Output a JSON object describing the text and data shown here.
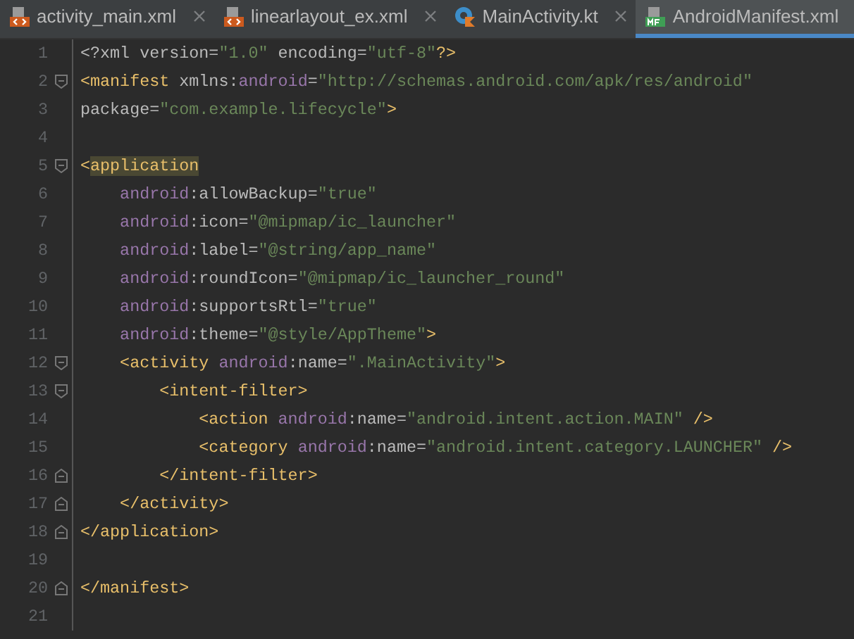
{
  "tabs": [
    {
      "label": "activity_main.xml",
      "kind": "xml",
      "selected": false
    },
    {
      "label": "linearlayout_ex.xml",
      "kind": "xml",
      "selected": false
    },
    {
      "label": "MainActivity.kt",
      "kind": "kotlin",
      "selected": false
    },
    {
      "label": "AndroidManifest.xml",
      "kind": "manifest",
      "selected": true
    }
  ],
  "editor": {
    "lines": [
      {
        "number": "1",
        "tokens": [
          {
            "kind": "plain",
            "text": "<?xml version="
          },
          {
            "kind": "value",
            "text": "\"1.0\""
          },
          {
            "kind": "plain",
            "text": " encoding="
          },
          {
            "kind": "value",
            "text": "\"utf-8\""
          },
          {
            "kind": "tag",
            "text": "?>"
          }
        ]
      },
      {
        "number": "2",
        "kind": "fold-start",
        "tokens": [
          {
            "kind": "tag",
            "text": "<manifest "
          },
          {
            "kind": "plain",
            "text": "xmlns:"
          },
          {
            "kind": "ns",
            "text": "android"
          },
          {
            "kind": "plain",
            "text": "="
          },
          {
            "kind": "value",
            "text": "\"http://schemas.android.com/apk/res/android\""
          }
        ]
      },
      {
        "number": "3",
        "tokens": [
          {
            "kind": "plain",
            "text": "package="
          },
          {
            "kind": "value",
            "text": "\"com.example.lifecycle\""
          },
          {
            "kind": "tag",
            "text": ">"
          }
        ]
      },
      {
        "number": "4"
      },
      {
        "number": "5",
        "kind": "fold-start",
        "tokens": [
          {
            "kind": "tag",
            "text": "<"
          },
          {
            "kind": "tag",
            "text": "application",
            "highlighted": true
          }
        ]
      },
      {
        "number": "6",
        "tokens": [
          {
            "kind": "ns",
            "text": "    android"
          },
          {
            "kind": "plain",
            "text": ":allowBackup="
          },
          {
            "kind": "value",
            "text": "\"true\""
          }
        ]
      },
      {
        "number": "7",
        "tokens": [
          {
            "kind": "ns",
            "text": "    android"
          },
          {
            "kind": "plain",
            "text": ":icon="
          },
          {
            "kind": "value",
            "text": "\"@mipmap/ic_launcher\""
          }
        ]
      },
      {
        "number": "8",
        "tokens": [
          {
            "kind": "ns",
            "text": "    android"
          },
          {
            "kind": "plain",
            "text": ":label="
          },
          {
            "kind": "value",
            "text": "\"@string/app_name\""
          }
        ]
      },
      {
        "number": "9",
        "tokens": [
          {
            "kind": "ns",
            "text": "    android"
          },
          {
            "kind": "plain",
            "text": ":roundIcon="
          },
          {
            "kind": "value",
            "text": "\"@mipmap/ic_launcher_round\""
          }
        ]
      },
      {
        "number": "10",
        "tokens": [
          {
            "kind": "ns",
            "text": "    android"
          },
          {
            "kind": "plain",
            "text": ":supportsRtl="
          },
          {
            "kind": "value",
            "text": "\"true\""
          }
        ]
      },
      {
        "number": "11",
        "tokens": [
          {
            "kind": "ns",
            "text": "    android"
          },
          {
            "kind": "plain",
            "text": ":theme="
          },
          {
            "kind": "value",
            "text": "\"@style/AppTheme\""
          },
          {
            "kind": "tag",
            "text": ">"
          }
        ]
      },
      {
        "number": "12",
        "kind": "fold-start",
        "tokens": [
          {
            "kind": "tag",
            "text": "    <activity "
          },
          {
            "kind": "ns",
            "text": "android"
          },
          {
            "kind": "plain",
            "text": ":name="
          },
          {
            "kind": "value",
            "text": "\".MainActivity\""
          },
          {
            "kind": "tag",
            "text": ">"
          }
        ]
      },
      {
        "number": "13",
        "kind": "fold-start",
        "tokens": [
          {
            "kind": "tag",
            "text": "        <intent-filter>"
          }
        ]
      },
      {
        "number": "14",
        "tokens": [
          {
            "kind": "tag",
            "text": "            <action "
          },
          {
            "kind": "ns",
            "text": "android"
          },
          {
            "kind": "plain",
            "text": ":name="
          },
          {
            "kind": "value",
            "text": "\"android.intent.action.MAIN\""
          },
          {
            "kind": "tag",
            "text": " />"
          }
        ]
      },
      {
        "number": "15",
        "tokens": [
          {
            "kind": "tag",
            "text": "            <category "
          },
          {
            "kind": "ns",
            "text": "android"
          },
          {
            "kind": "plain",
            "text": ":name="
          },
          {
            "kind": "value",
            "text": "\"android.intent.category.LAUNCHER\""
          },
          {
            "kind": "tag",
            "text": " />"
          }
        ]
      },
      {
        "number": "16",
        "kind": "fold-end",
        "tokens": [
          {
            "kind": "tag",
            "text": "        </intent-filter>"
          }
        ]
      },
      {
        "number": "17",
        "kind": "fold-end",
        "tokens": [
          {
            "kind": "tag",
            "text": "    </activity>"
          }
        ]
      },
      {
        "number": "18",
        "kind": "fold-end",
        "tokens": [
          {
            "kind": "tag",
            "text": "</application>"
          }
        ]
      },
      {
        "number": "19"
      },
      {
        "number": "20",
        "kind": "fold-end",
        "tokens": [
          {
            "kind": "tag",
            "text": "</manifest>"
          }
        ]
      },
      {
        "number": "21"
      }
    ]
  }
}
